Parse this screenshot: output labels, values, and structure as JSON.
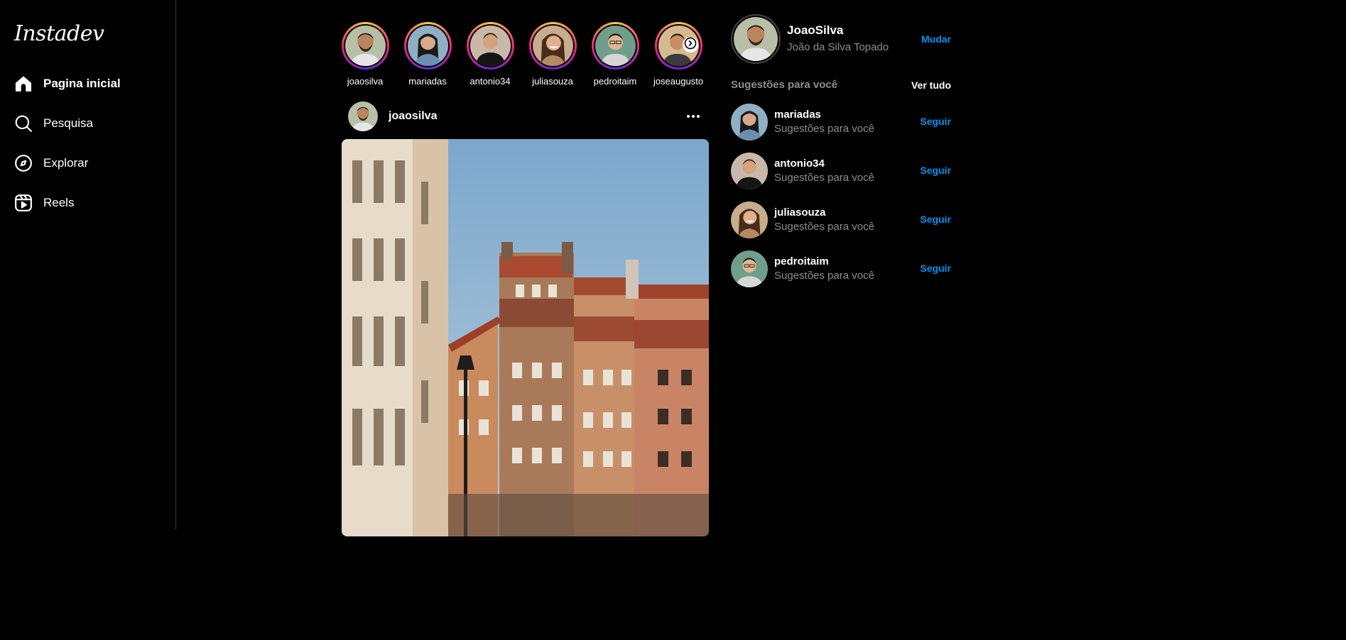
{
  "sidebar": {
    "logo": "Instadev",
    "items": [
      {
        "label": "Pagina inicial",
        "icon": "home-icon",
        "active": true
      },
      {
        "label": "Pesquisa",
        "icon": "search-icon",
        "active": false
      },
      {
        "label": "Explorar",
        "icon": "compass-icon",
        "active": false
      },
      {
        "label": "Reels",
        "icon": "reels-icon",
        "active": false
      }
    ]
  },
  "stories": [
    {
      "name": "joaosilva"
    },
    {
      "name": "mariadas"
    },
    {
      "name": "antonio34"
    },
    {
      "name": "juliasouza"
    },
    {
      "name": "pedroitaim"
    },
    {
      "name": "joseaugusto"
    }
  ],
  "post": {
    "username": "joaosilva",
    "more_icon": "more-horizontal-icon"
  },
  "profile": {
    "username": "JoaoSilva",
    "fullname": "João da Silva Topado",
    "switch_label": "Mudar"
  },
  "suggestions": {
    "title": "Sugestões para você",
    "see_all": "Ver tudo",
    "items": [
      {
        "name": "mariadas",
        "subtitle": "Sugestões para você",
        "action": "Seguir"
      },
      {
        "name": "antonio34",
        "subtitle": "Sugestões para você",
        "action": "Seguir"
      },
      {
        "name": "juliasouza",
        "subtitle": "Sugestões para você",
        "action": "Seguir"
      },
      {
        "name": "pedroitaim",
        "subtitle": "Sugestões para você",
        "action": "Seguir"
      }
    ]
  },
  "colors": {
    "background": "#000000",
    "accent": "#0095f6",
    "muted": "#8e8e8e",
    "divider": "#3a3a3a"
  }
}
